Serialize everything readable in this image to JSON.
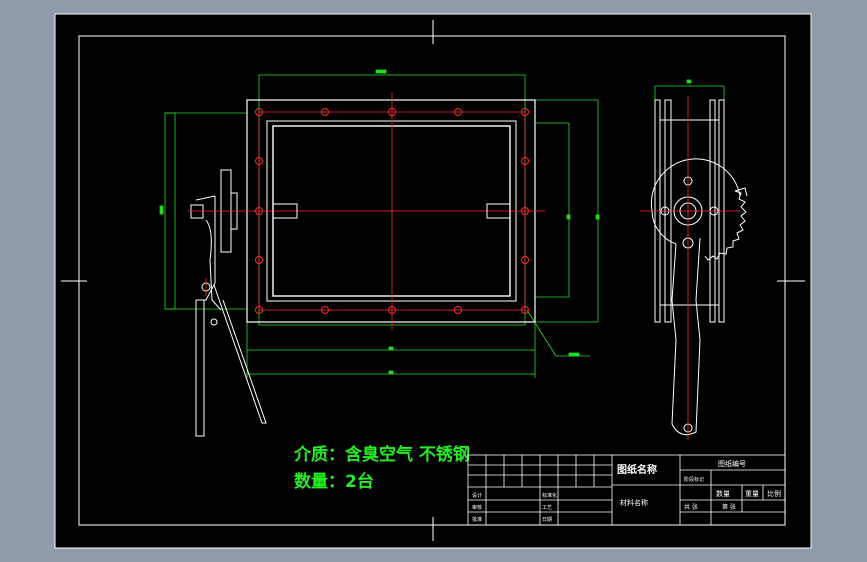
{
  "colors": {
    "frame_bg": "#8f9aaa",
    "sheet": "#000000",
    "outline": "#ffffff",
    "centerline": "#ff2a2a",
    "dimension": "#22dd22",
    "note": "#22ee22"
  },
  "notes": {
    "medium": "介质：含臭空气 不锈钢",
    "quantity": "数量：2台"
  },
  "title_block": {
    "drawing_name_label": "图纸名称",
    "drawing_number_label": "图纸编号",
    "material_label": "材料名称",
    "row_labels": [
      "设计",
      "审核",
      "批准"
    ],
    "mid_labels": [
      "标准化",
      "工艺",
      "日期"
    ],
    "stage_marking": "阶段标记",
    "cols": [
      "数量",
      "重量",
      "比例"
    ],
    "sheet_total": "共 张",
    "sheet_num": "第 张"
  },
  "icons": {
    "bolt_hole": "bolt-hole-icon",
    "centering_mark": "centering-mark-icon"
  }
}
